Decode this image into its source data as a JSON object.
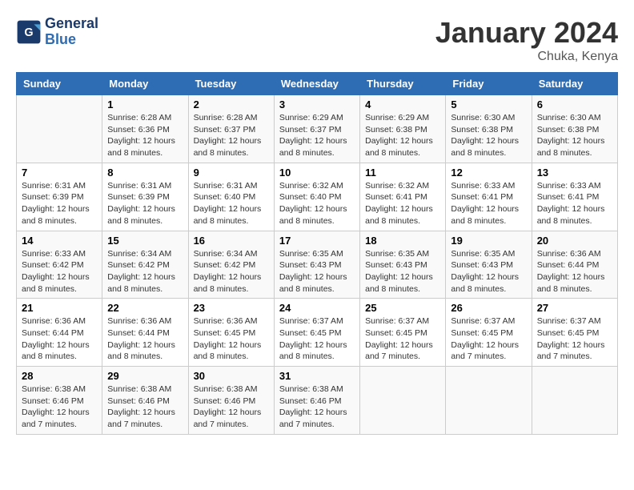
{
  "logo": {
    "line1": "General",
    "line2": "Blue"
  },
  "title": "January 2024",
  "subtitle": "Chuka, Kenya",
  "headers": [
    "Sunday",
    "Monday",
    "Tuesday",
    "Wednesday",
    "Thursday",
    "Friday",
    "Saturday"
  ],
  "weeks": [
    [
      {
        "day": "",
        "sunrise": "",
        "sunset": "",
        "daylight": ""
      },
      {
        "day": "1",
        "sunrise": "Sunrise: 6:28 AM",
        "sunset": "Sunset: 6:36 PM",
        "daylight": "Daylight: 12 hours and 8 minutes."
      },
      {
        "day": "2",
        "sunrise": "Sunrise: 6:28 AM",
        "sunset": "Sunset: 6:37 PM",
        "daylight": "Daylight: 12 hours and 8 minutes."
      },
      {
        "day": "3",
        "sunrise": "Sunrise: 6:29 AM",
        "sunset": "Sunset: 6:37 PM",
        "daylight": "Daylight: 12 hours and 8 minutes."
      },
      {
        "day": "4",
        "sunrise": "Sunrise: 6:29 AM",
        "sunset": "Sunset: 6:38 PM",
        "daylight": "Daylight: 12 hours and 8 minutes."
      },
      {
        "day": "5",
        "sunrise": "Sunrise: 6:30 AM",
        "sunset": "Sunset: 6:38 PM",
        "daylight": "Daylight: 12 hours and 8 minutes."
      },
      {
        "day": "6",
        "sunrise": "Sunrise: 6:30 AM",
        "sunset": "Sunset: 6:38 PM",
        "daylight": "Daylight: 12 hours and 8 minutes."
      }
    ],
    [
      {
        "day": "7",
        "sunrise": "Sunrise: 6:31 AM",
        "sunset": "Sunset: 6:39 PM",
        "daylight": "Daylight: 12 hours and 8 minutes."
      },
      {
        "day": "8",
        "sunrise": "Sunrise: 6:31 AM",
        "sunset": "Sunset: 6:39 PM",
        "daylight": "Daylight: 12 hours and 8 minutes."
      },
      {
        "day": "9",
        "sunrise": "Sunrise: 6:31 AM",
        "sunset": "Sunset: 6:40 PM",
        "daylight": "Daylight: 12 hours and 8 minutes."
      },
      {
        "day": "10",
        "sunrise": "Sunrise: 6:32 AM",
        "sunset": "Sunset: 6:40 PM",
        "daylight": "Daylight: 12 hours and 8 minutes."
      },
      {
        "day": "11",
        "sunrise": "Sunrise: 6:32 AM",
        "sunset": "Sunset: 6:41 PM",
        "daylight": "Daylight: 12 hours and 8 minutes."
      },
      {
        "day": "12",
        "sunrise": "Sunrise: 6:33 AM",
        "sunset": "Sunset: 6:41 PM",
        "daylight": "Daylight: 12 hours and 8 minutes."
      },
      {
        "day": "13",
        "sunrise": "Sunrise: 6:33 AM",
        "sunset": "Sunset: 6:41 PM",
        "daylight": "Daylight: 12 hours and 8 minutes."
      }
    ],
    [
      {
        "day": "14",
        "sunrise": "Sunrise: 6:33 AM",
        "sunset": "Sunset: 6:42 PM",
        "daylight": "Daylight: 12 hours and 8 minutes."
      },
      {
        "day": "15",
        "sunrise": "Sunrise: 6:34 AM",
        "sunset": "Sunset: 6:42 PM",
        "daylight": "Daylight: 12 hours and 8 minutes."
      },
      {
        "day": "16",
        "sunrise": "Sunrise: 6:34 AM",
        "sunset": "Sunset: 6:42 PM",
        "daylight": "Daylight: 12 hours and 8 minutes."
      },
      {
        "day": "17",
        "sunrise": "Sunrise: 6:35 AM",
        "sunset": "Sunset: 6:43 PM",
        "daylight": "Daylight: 12 hours and 8 minutes."
      },
      {
        "day": "18",
        "sunrise": "Sunrise: 6:35 AM",
        "sunset": "Sunset: 6:43 PM",
        "daylight": "Daylight: 12 hours and 8 minutes."
      },
      {
        "day": "19",
        "sunrise": "Sunrise: 6:35 AM",
        "sunset": "Sunset: 6:43 PM",
        "daylight": "Daylight: 12 hours and 8 minutes."
      },
      {
        "day": "20",
        "sunrise": "Sunrise: 6:36 AM",
        "sunset": "Sunset: 6:44 PM",
        "daylight": "Daylight: 12 hours and 8 minutes."
      }
    ],
    [
      {
        "day": "21",
        "sunrise": "Sunrise: 6:36 AM",
        "sunset": "Sunset: 6:44 PM",
        "daylight": "Daylight: 12 hours and 8 minutes."
      },
      {
        "day": "22",
        "sunrise": "Sunrise: 6:36 AM",
        "sunset": "Sunset: 6:44 PM",
        "daylight": "Daylight: 12 hours and 8 minutes."
      },
      {
        "day": "23",
        "sunrise": "Sunrise: 6:36 AM",
        "sunset": "Sunset: 6:45 PM",
        "daylight": "Daylight: 12 hours and 8 minutes."
      },
      {
        "day": "24",
        "sunrise": "Sunrise: 6:37 AM",
        "sunset": "Sunset: 6:45 PM",
        "daylight": "Daylight: 12 hours and 8 minutes."
      },
      {
        "day": "25",
        "sunrise": "Sunrise: 6:37 AM",
        "sunset": "Sunset: 6:45 PM",
        "daylight": "Daylight: 12 hours and 7 minutes."
      },
      {
        "day": "26",
        "sunrise": "Sunrise: 6:37 AM",
        "sunset": "Sunset: 6:45 PM",
        "daylight": "Daylight: 12 hours and 7 minutes."
      },
      {
        "day": "27",
        "sunrise": "Sunrise: 6:37 AM",
        "sunset": "Sunset: 6:45 PM",
        "daylight": "Daylight: 12 hours and 7 minutes."
      }
    ],
    [
      {
        "day": "28",
        "sunrise": "Sunrise: 6:38 AM",
        "sunset": "Sunset: 6:46 PM",
        "daylight": "Daylight: 12 hours and 7 minutes."
      },
      {
        "day": "29",
        "sunrise": "Sunrise: 6:38 AM",
        "sunset": "Sunset: 6:46 PM",
        "daylight": "Daylight: 12 hours and 7 minutes."
      },
      {
        "day": "30",
        "sunrise": "Sunrise: 6:38 AM",
        "sunset": "Sunset: 6:46 PM",
        "daylight": "Daylight: 12 hours and 7 minutes."
      },
      {
        "day": "31",
        "sunrise": "Sunrise: 6:38 AM",
        "sunset": "Sunset: 6:46 PM",
        "daylight": "Daylight: 12 hours and 7 minutes."
      },
      {
        "day": "",
        "sunrise": "",
        "sunset": "",
        "daylight": ""
      },
      {
        "day": "",
        "sunrise": "",
        "sunset": "",
        "daylight": ""
      },
      {
        "day": "",
        "sunrise": "",
        "sunset": "",
        "daylight": ""
      }
    ]
  ]
}
